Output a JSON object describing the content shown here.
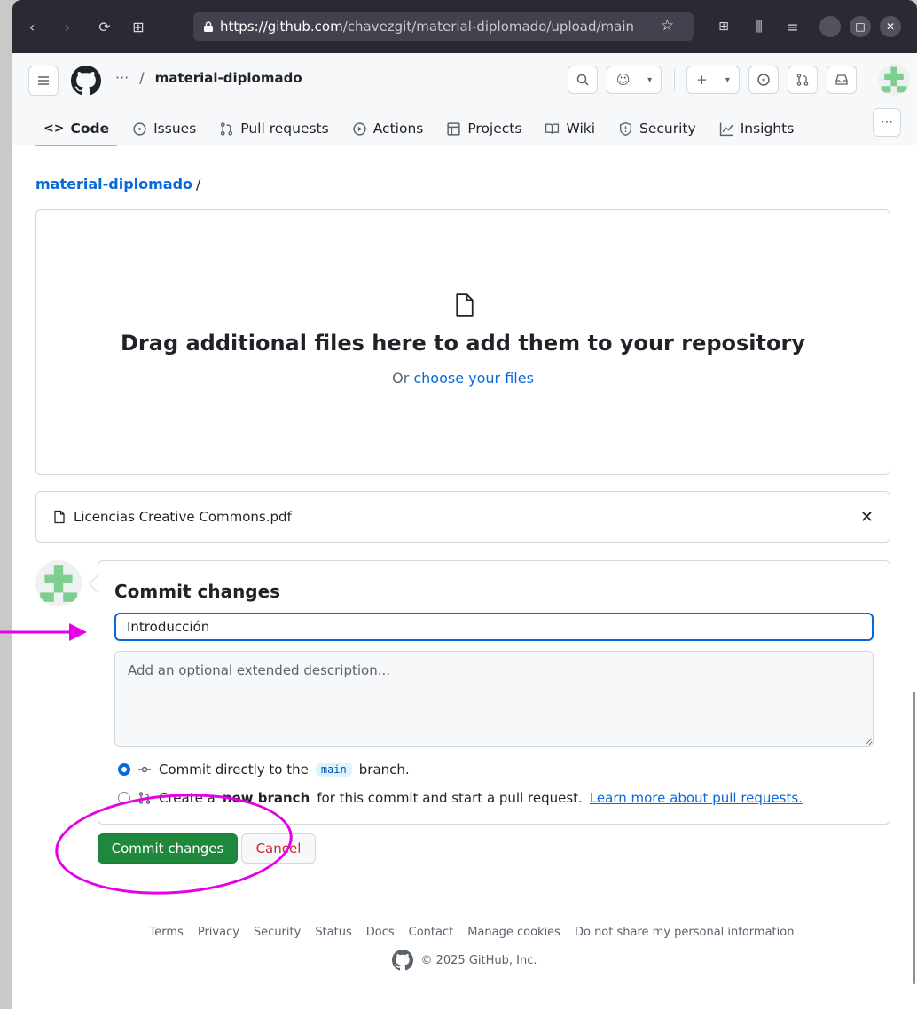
{
  "browser": {
    "url_host": "https://github.com",
    "url_path": "/chavezgit/material-diplomado/upload/main"
  },
  "header": {
    "breadcrumb_dots": "···",
    "breadcrumb_sep": "/",
    "repo_name": "material-diplomado"
  },
  "tabs": [
    {
      "label": "Code"
    },
    {
      "label": "Issues"
    },
    {
      "label": "Pull requests"
    },
    {
      "label": "Actions"
    },
    {
      "label": "Projects"
    },
    {
      "label": "Wiki"
    },
    {
      "label": "Security"
    },
    {
      "label": "Insights"
    }
  ],
  "page": {
    "repo_link": "material-diplomado",
    "repo_sep": "/",
    "dropzone_title": "Drag additional files here to add them to your repository",
    "dropzone_or": "Or",
    "dropzone_choose": "choose your files",
    "uploaded_file": "Licencias Creative Commons.pdf"
  },
  "commit": {
    "title": "Commit changes",
    "summary_value": "Introducción",
    "description_placeholder": "Add an optional extended description...",
    "option_direct_prefix": "Commit directly to the",
    "option_direct_branch": "main",
    "option_direct_suffix": "branch.",
    "option_new_prefix": "Create a",
    "option_new_bold": "new branch",
    "option_new_suffix": "for this commit and start a pull request.",
    "option_new_link": "Learn more about pull requests.",
    "commit_button": "Commit changes",
    "cancel_button": "Cancel"
  },
  "footer": {
    "links": [
      "Terms",
      "Privacy",
      "Security",
      "Status",
      "Docs",
      "Contact",
      "Manage cookies",
      "Do not share my personal information"
    ],
    "copyright": "© 2025 GitHub, Inc."
  },
  "colors": {
    "accent_blue": "#0969da",
    "commit_green": "#1f883d",
    "annotation_magenta": "#e600e6",
    "tab_underline": "#fd8c73"
  }
}
